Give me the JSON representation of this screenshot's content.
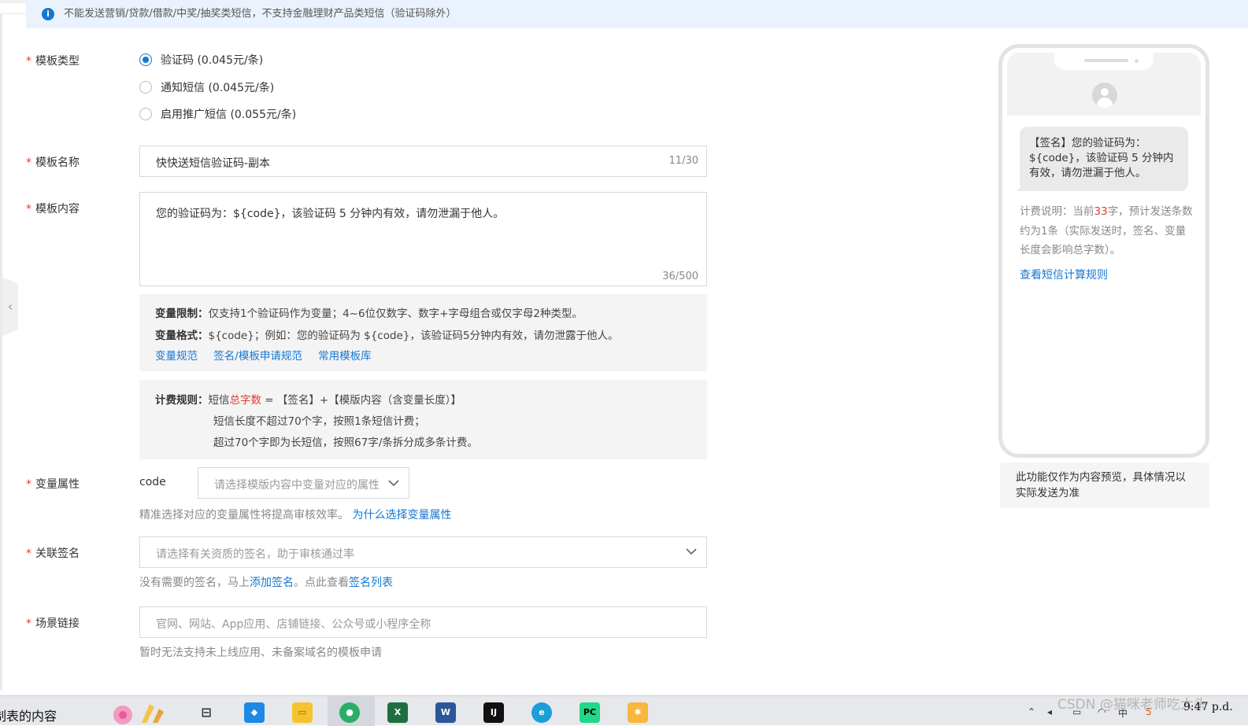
{
  "banner": {
    "text": "不能发送营销/贷款/借款/中奖/抽奖类短信，不支持金融理财产品类短信（验证码除外）"
  },
  "template_type": {
    "label": "模板类型",
    "options": [
      {
        "label": "验证码 (0.045元/条)",
        "checked": true
      },
      {
        "label": "通知短信 (0.045元/条)",
        "checked": false
      },
      {
        "label": "启用推广短信 (0.055元/条)",
        "checked": false
      }
    ]
  },
  "template_name": {
    "label": "模板名称",
    "value": "快快送短信验证码-副本",
    "count": "11/30"
  },
  "template_content": {
    "label": "模板内容",
    "value": "您的验证码为：${code}，该验证码 5 分钟内有效，请勿泄漏于他人。",
    "count": "36/500"
  },
  "variable_info": {
    "limit_title": "变量限制：",
    "limit_text": "仅支持1个验证码作为变量；4~6位仅数字、数字+字母组合或仅字母2种类型。",
    "format_title": "变量格式：",
    "format_text": "${code}；例如：您的验证码为 ${code}，该验证码5分钟内有效，请勿泄露于他人。",
    "links": [
      "变量规范",
      "签名/模板申请规范",
      "常用模板库"
    ]
  },
  "billing_rules": {
    "title": "计费规则：",
    "line1_pre": "短信",
    "line1_red": "总字数",
    "line1_post": " = 【签名】+【模版内容（含变量长度）】",
    "line2": "短信长度不超过70个字，按照1条短信计费；",
    "line3": "超过70个字即为长短信，按照67字/条拆分成多条计费。"
  },
  "variable_attr": {
    "label": "变量属性",
    "var_name": "code",
    "placeholder": "请选择模版内容中变量对应的属性",
    "hint": "精准选择对应的变量属性将提高审核效率。",
    "hint_link": "为什么选择变量属性"
  },
  "signature": {
    "label": "关联签名",
    "placeholder": "请选择有关资质的签名，助于审核通过率",
    "hint_pre": "没有需要的签名，马上",
    "hint_link1": "添加签名",
    "hint_mid": "。点此查看",
    "hint_link2": "签名列表"
  },
  "scene_link": {
    "label": "场景链接",
    "placeholder": "官网、网站、App应用、店铺链接、公众号或小程序全称",
    "hint": "暂时无法支持未上线应用、未备案域名的模板申请"
  },
  "preview": {
    "bubble": "【签名】您的验证码为：${code}，该验证码 5 分钟内有效，请勿泄漏于他人。",
    "fee_pre": "计费说明：当前",
    "fee_count": "33",
    "fee_post": "字，预计发送条数约为1条（实际发送时，签名、变量长度会影响总字数）。",
    "link": "查看短信计算规则",
    "note": "此功能仅作为内容预览，具体情况以实际发送为准"
  },
  "taskbar": {
    "app_text": "制表的内容",
    "watermark": "CSDN @猫咪老师吃大头",
    "clock": "9:47 p.d."
  },
  "colors": {
    "accent": "#1677d2",
    "required": "#e53935",
    "banner_bg": "#eaf3fd"
  }
}
